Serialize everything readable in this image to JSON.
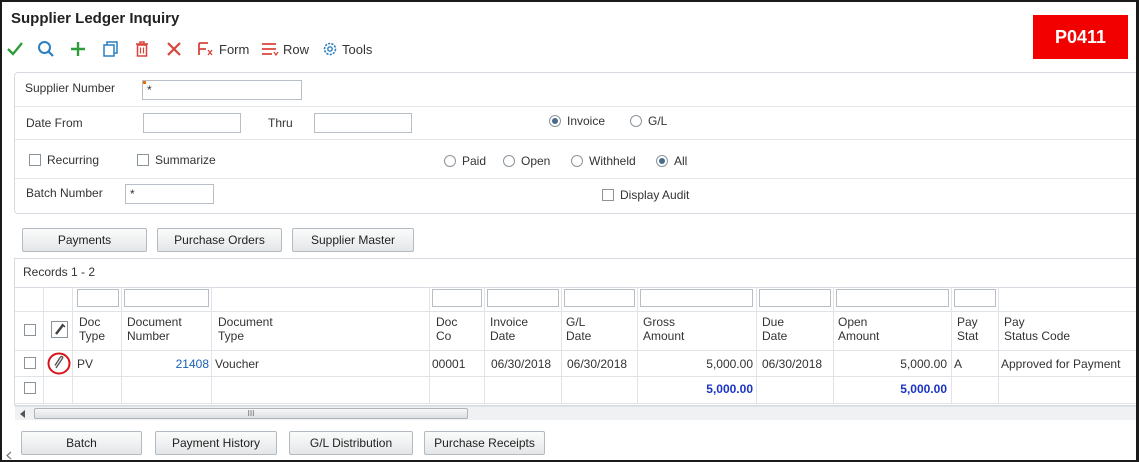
{
  "app": {
    "title": "Supplier Ledger Inquiry",
    "code": "P0411"
  },
  "toolbar": {
    "form_label": "Form",
    "row_label": "Row",
    "tools_label": "Tools"
  },
  "filters": {
    "supplier_number_label": "Supplier Number",
    "supplier_number_value": "*",
    "date_from_label": "Date From",
    "date_from_value": "",
    "thru_label": "Thru",
    "thru_value": "",
    "invoice_label": "Invoice",
    "gl_label": "G/L",
    "recurring_label": "Recurring",
    "summarize_label": "Summarize",
    "paid_label": "Paid",
    "open_label": "Open",
    "withheld_label": "Withheld",
    "all_label": "All",
    "batch_number_label": "Batch Number",
    "batch_number_value": "*",
    "display_audit_label": "Display Audit"
  },
  "top_buttons": {
    "payments": "Payments",
    "purchase_orders": "Purchase Orders",
    "supplier_master": "Supplier Master"
  },
  "grid": {
    "records_label": "Records 1 - 2",
    "headers": {
      "doc_type": [
        "Doc",
        "Type"
      ],
      "document_number": [
        "Document",
        "Number"
      ],
      "document_type": [
        "Document",
        "Type"
      ],
      "doc_co": [
        "Doc",
        "Co"
      ],
      "invoice_date": [
        "Invoice",
        "Date"
      ],
      "gl_date": [
        "G/L",
        "Date"
      ],
      "gross_amount": [
        "Gross",
        "Amount"
      ],
      "due_date": [
        "Due",
        "Date"
      ],
      "open_amount": [
        "Open",
        "Amount"
      ],
      "pay_stat": [
        "Pay",
        "Stat"
      ],
      "pay_status_code": [
        "Pay",
        "Status Code"
      ]
    },
    "rows": [
      {
        "doc_type": "PV",
        "document_number": "21408",
        "document_type": "Voucher",
        "doc_co": "00001",
        "invoice_date": "06/30/2018",
        "gl_date": "06/30/2018",
        "gross_amount": "5,000.00",
        "due_date": "06/30/2018",
        "open_amount": "5,000.00",
        "pay_stat": "A",
        "pay_status_code": "Approved for Payment"
      }
    ],
    "totals": {
      "gross_amount": "5,000.00",
      "open_amount": "5,000.00"
    },
    "scroll_grip": "III"
  },
  "bottom_buttons": {
    "batch": "Batch",
    "payment_history": "Payment History",
    "gl_distribution": "G/L Distribution",
    "purchase_receipts": "Purchase Receipts"
  },
  "colors": {
    "accent_red": "#f20000",
    "link_blue": "#1a5fb4",
    "check_green": "#2e9d3a"
  }
}
